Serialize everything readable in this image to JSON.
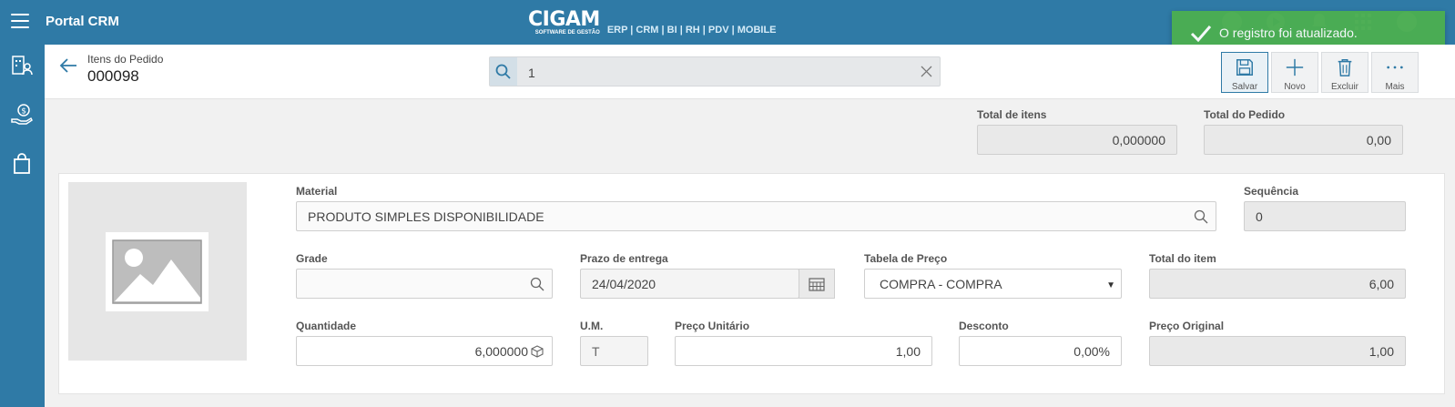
{
  "header": {
    "app_title": "Portal CRM",
    "brand_name": "CIGAM",
    "brand_tagline": "SOFTWARE DE GESTÃO",
    "brand_links": "ERP | CRM | BI | RH | PDV | MOBILE"
  },
  "toast": {
    "message": "O registro foi atualizado.",
    "color": "#4caf50"
  },
  "subheader": {
    "label": "Itens do Pedido",
    "code": "000098",
    "search_value": "1"
  },
  "actions": [
    {
      "label": "Salvar",
      "icon": "save-icon"
    },
    {
      "label": "Novo",
      "icon": "plus-icon"
    },
    {
      "label": "Excluir",
      "icon": "trash-icon"
    },
    {
      "label": "Mais",
      "icon": "more-icon"
    }
  ],
  "totals": {
    "total_itens_label": "Total de itens",
    "total_itens_value": "0,000000",
    "total_pedido_label": "Total do Pedido",
    "total_pedido_value": "0,00"
  },
  "form": {
    "material_label": "Material",
    "material_value": "PRODUTO SIMPLES DISPONIBILIDADE",
    "sequencia_label": "Sequência",
    "sequencia_value": "0",
    "grade_label": "Grade",
    "grade_value": "",
    "prazo_label": "Prazo de entrega",
    "prazo_value": "24/04/2020",
    "tabela_label": "Tabela de Preço",
    "tabela_value": "COMPRA - COMPRA",
    "total_item_label": "Total do item",
    "total_item_value": "6,00",
    "quantidade_label": "Quantidade",
    "quantidade_value": "6,000000",
    "um_label": "U.M.",
    "um_value": "T",
    "preco_label": "Preço Unitário",
    "preco_value": "1,00",
    "desconto_label": "Desconto",
    "desconto_value": "0,00%",
    "preco_original_label": "Preço Original",
    "preco_original_value": "1,00"
  },
  "colors": {
    "primary": "#2f7aa6"
  }
}
